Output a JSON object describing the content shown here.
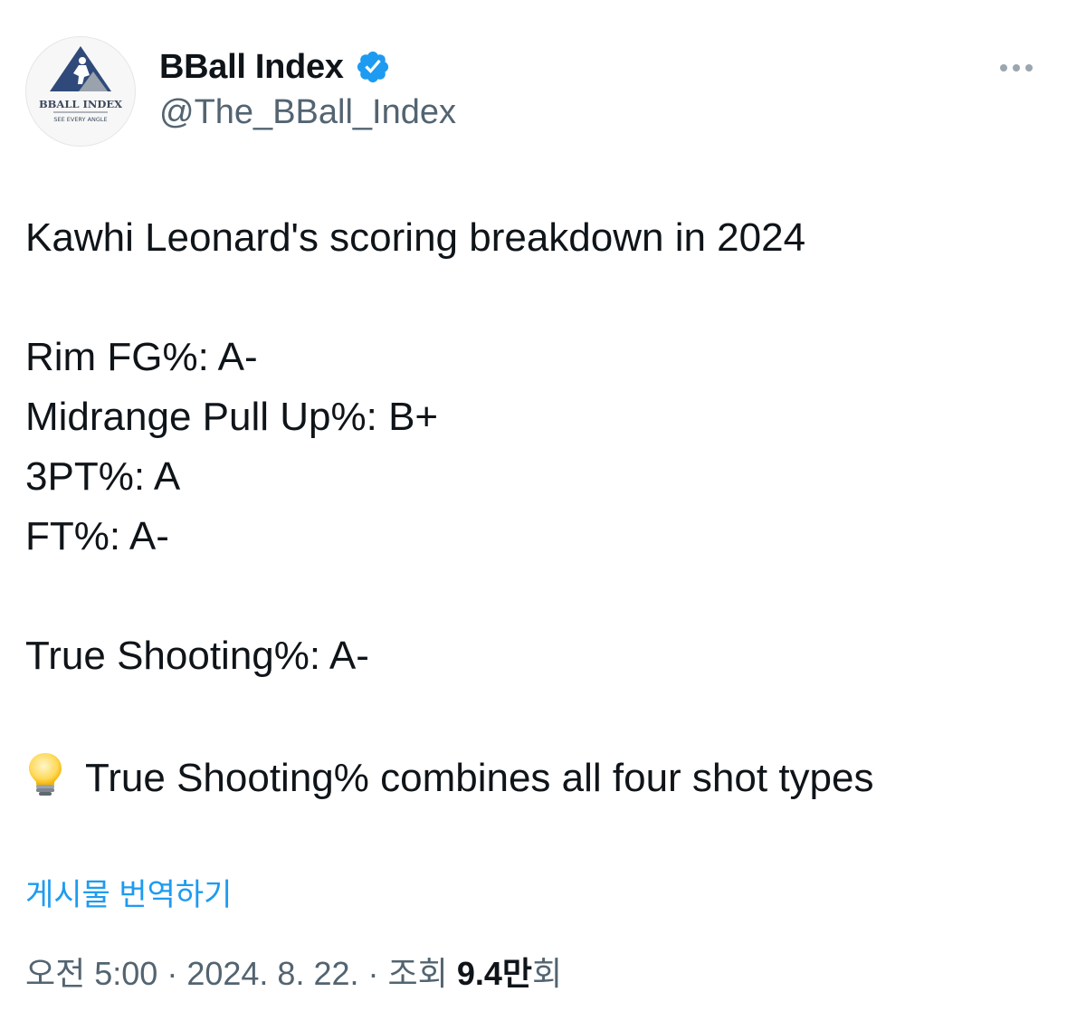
{
  "author": {
    "display_name": "BBall Index",
    "handle": "@The_BBall_Index",
    "verified": true,
    "avatar_text": "BBALL INDEX",
    "avatar_tagline": "SEE EVERY ANGLE"
  },
  "tweet": {
    "headline": "Kawhi Leonard's scoring breakdown in 2024",
    "grades": [
      "Rim FG%: A-",
      "Midrange Pull Up%: B+",
      "3PT%: A",
      "FT%: A-"
    ],
    "summary": "True Shooting%: A-",
    "note_icon": "lightbulb-icon",
    "note": "True Shooting% combines all four shot types"
  },
  "actions": {
    "translate_label": "게시물 번역하기",
    "more_icon": "more-options-icon"
  },
  "meta": {
    "time": "오전 5:00",
    "separator": "·",
    "date": "2024. 8. 22.",
    "views_label": "조회",
    "views_count": "9.4만",
    "views_suffix": "회"
  },
  "colors": {
    "text": "#0f1419",
    "secondary": "#536471",
    "link": "#1d9bf0",
    "verified": "#1d9bf0"
  }
}
